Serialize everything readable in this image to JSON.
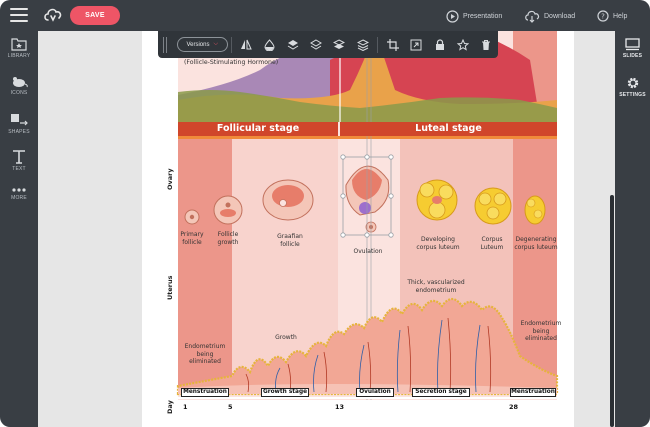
{
  "topbar": {
    "save_label": "SAVE",
    "presentation_label": "Presentation",
    "download_label": "Download",
    "help_label": "Help"
  },
  "left_rail": [
    {
      "label": "LIBRARY",
      "icon": "library-icon"
    },
    {
      "label": "ICONS",
      "icon": "mouse-icon"
    },
    {
      "label": "SHAPES",
      "icon": "shapes-icon"
    },
    {
      "label": "TEXT",
      "icon": "text-icon"
    },
    {
      "label": "MORE",
      "icon": "more-icon"
    }
  ],
  "right_rail": [
    {
      "label": "SLIDES",
      "icon": "slides-icon"
    },
    {
      "label": "SETTINGS",
      "icon": "gear-icon"
    }
  ],
  "toolbar": {
    "versions_label": "Versions",
    "tools": [
      "flip-icon",
      "opacity-icon",
      "bring-front-icon",
      "bring-forward-icon",
      "send-backward-icon",
      "send-back-icon",
      "crop-icon",
      "fullscreen-icon",
      "lock-icon",
      "star-icon",
      "trash-icon"
    ]
  },
  "diagram": {
    "hormone_label": "(Follicle-Stimulating Hormone)",
    "stages": {
      "follicular": "Follicular stage",
      "luteal": "Luteal stage"
    },
    "row_labels": {
      "ovary": "Ovary",
      "uterus": "Uterus",
      "day": "Day"
    },
    "ovary_labels": {
      "primary": "Primary\nfollicle",
      "growth": "Follicle\ngrowth",
      "graafian": "Graafian\nfollicle",
      "ovulation": "Ovulation",
      "developing": "Developing\ncorpus luteum",
      "corpus": "Corpus\nLuteum",
      "degenerating": "Degenerating\ncorpus luteum"
    },
    "uterus_labels": {
      "thick": "Thick, vascularized\nendometrium",
      "growth": "Growth",
      "endo_left": "Endometrium\nbeing\neliminated",
      "endo_right": "Endometrium\nbeing\neliminated"
    },
    "phases": [
      "Menstruation",
      "Growth stage",
      "Ovulation",
      "Secretion stage",
      "Menstruation"
    ],
    "days": [
      "1",
      "5",
      "13",
      "28"
    ]
  },
  "colors": {
    "topbar": "#393e44",
    "save": "#ee5566",
    "stage_band": "#d0462b",
    "menses_band": "#ec968a"
  }
}
